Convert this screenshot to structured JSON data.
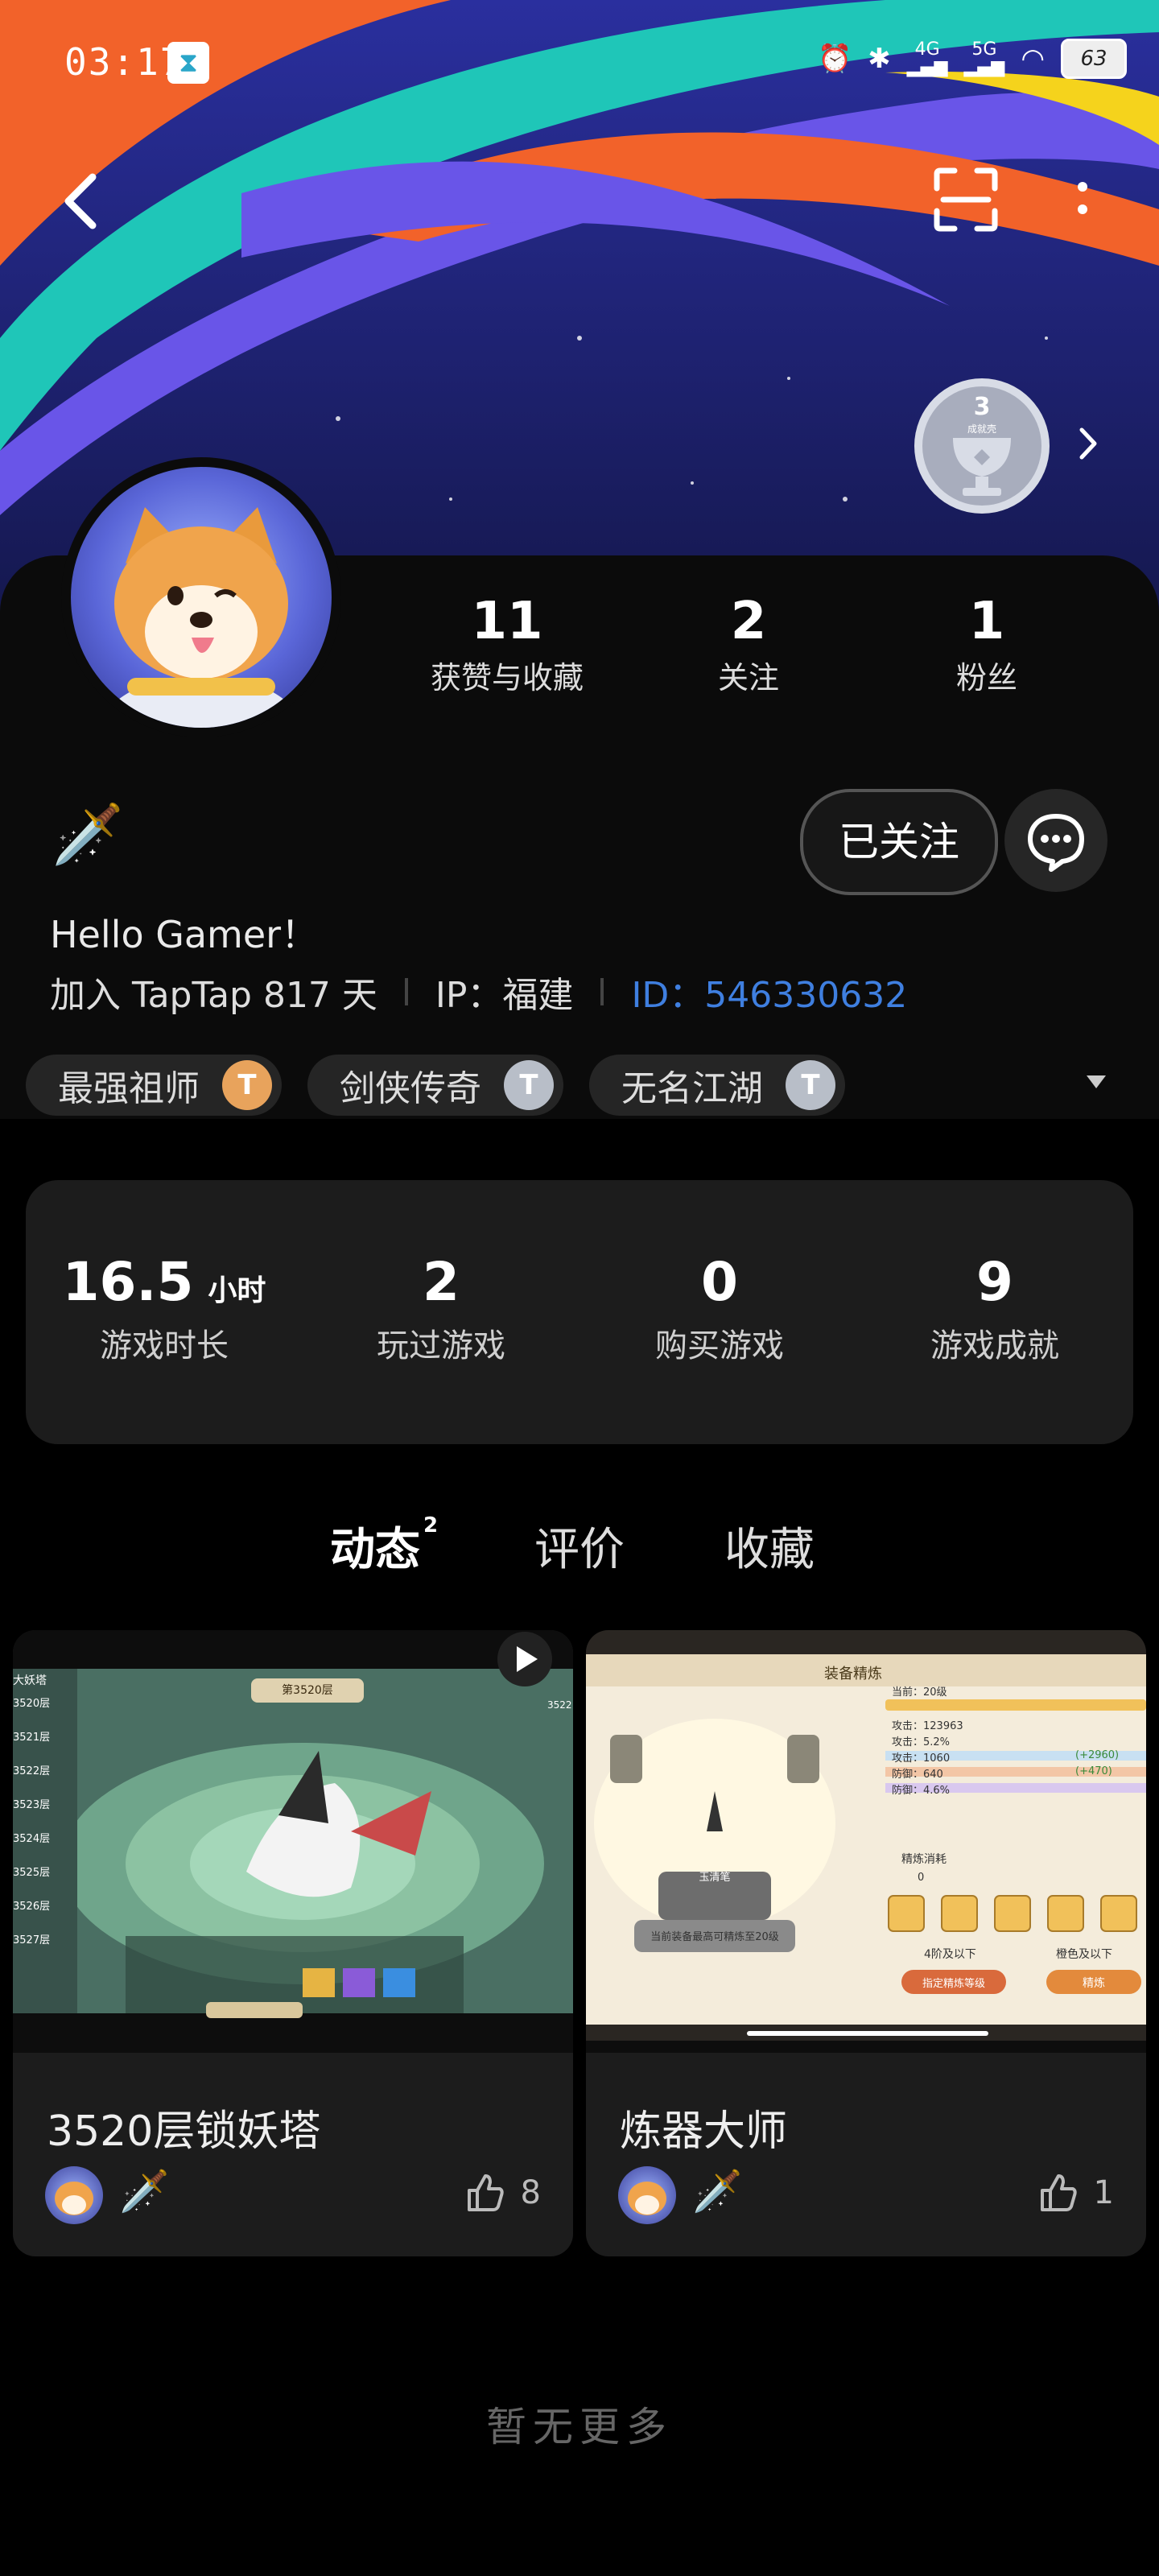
{
  "status_bar": {
    "time": "03:17",
    "net1": "4G",
    "net2": "5G",
    "battery": "63"
  },
  "achievement": {
    "count": "3",
    "label": "成就壳"
  },
  "profile_stats": [
    {
      "num": "11",
      "label": "获赞与收藏"
    },
    {
      "num": "2",
      "label": "关注"
    },
    {
      "num": "1",
      "label": "粉丝"
    }
  ],
  "follow_label": "已关注",
  "bio": "Hello Gamer！",
  "meta": {
    "joined": "加入 TapTap 817 天",
    "ip": "IP：福建",
    "id": "ID：546330632"
  },
  "tags": [
    {
      "label": "最强祖师",
      "badge": "T",
      "color": "#e8a35c"
    },
    {
      "label": "剑侠传奇",
      "badge": "T",
      "color": "#b8bec8"
    },
    {
      "label": "无名江湖",
      "badge": "T",
      "color": "#b8bec8"
    }
  ],
  "game_stats": [
    {
      "num": "16.5",
      "unit": "小时",
      "label": "游戏时长"
    },
    {
      "num": "2",
      "unit": "",
      "label": "玩过游戏"
    },
    {
      "num": "0",
      "unit": "",
      "label": "购买游戏"
    },
    {
      "num": "9",
      "unit": "",
      "label": "游戏成就"
    }
  ],
  "tabs": [
    {
      "label": "动态",
      "sup": "2"
    },
    {
      "label": "评价",
      "sup": ""
    },
    {
      "label": "收藏",
      "sup": ""
    }
  ],
  "posts": [
    {
      "title": "3520层锁妖塔",
      "likes": "8",
      "img": {
        "header": "第3520层",
        "side_title": "大妖塔",
        "right_label": "3522",
        "floors": [
          "3520层",
          "3521层",
          "3522层",
          "3523层",
          "3524层",
          "3525层",
          "3526层",
          "3527层"
        ]
      }
    },
    {
      "title": "炼器大师",
      "likes": "1",
      "img": {
        "header": "装备精炼",
        "current": "当前：20级",
        "attrs": [
          "攻击：123963",
          "攻击：5.2%",
          "攻击：1060",
          "防御：640",
          "防御：4.6%"
        ],
        "bonus1": "(+2960)",
        "bonus2": "(+470)",
        "plate": "玉清笔",
        "note": "当前装备最高可精炼至20级",
        "cost_label": "精炼消耗",
        "cost_value": "0",
        "select1": "4阶及以下",
        "select2": "橙色及以下",
        "btn1": "指定精炼等级",
        "btn2": "精炼"
      }
    }
  ],
  "no_more": "暂无更多"
}
